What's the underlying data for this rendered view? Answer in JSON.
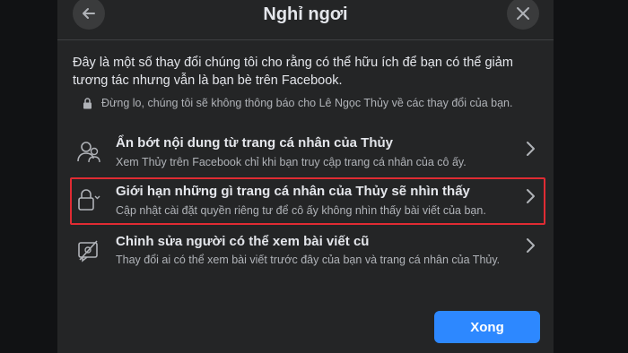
{
  "dialog": {
    "title": "Nghỉ ngơi",
    "intro": "Đây là một số thay đổi chúng tôi cho rằng có thể hữu ích để bạn có thể giảm tương tác nhưng vẫn là bạn bè trên Facebook.",
    "notice": "Đừng lo, chúng tôi sẽ không thông báo cho Lê Ngọc Thủy về các thay đổi của bạn.",
    "options": [
      {
        "icon": "profile-hide-icon",
        "title": "Ẩn bớt nội dung từ trang cá nhân của Thủy",
        "description": "Xem Thủy trên Facebook chỉ khi bạn truy cập trang cá nhân của cô ấy."
      },
      {
        "icon": "lock-limit-icon",
        "title": "Giới hạn những gì trang cá nhân của Thủy sẽ nhìn thấy",
        "description": "Cập nhật cài đặt quyền riêng tư để cô ấy không nhìn thấy bài viết của bạn."
      },
      {
        "icon": "hidden-posts-icon",
        "title": "Chỉnh sửa người có thể xem bài viết cũ",
        "description": "Thay đổi ai có thể xem bài viết trước đây của bạn và trang cá nhân của Thủy."
      }
    ],
    "done_label": "Xong"
  },
  "colors": {
    "background": "#242526",
    "primary_button": "#2d88ff",
    "highlight_border": "#e02b33"
  }
}
